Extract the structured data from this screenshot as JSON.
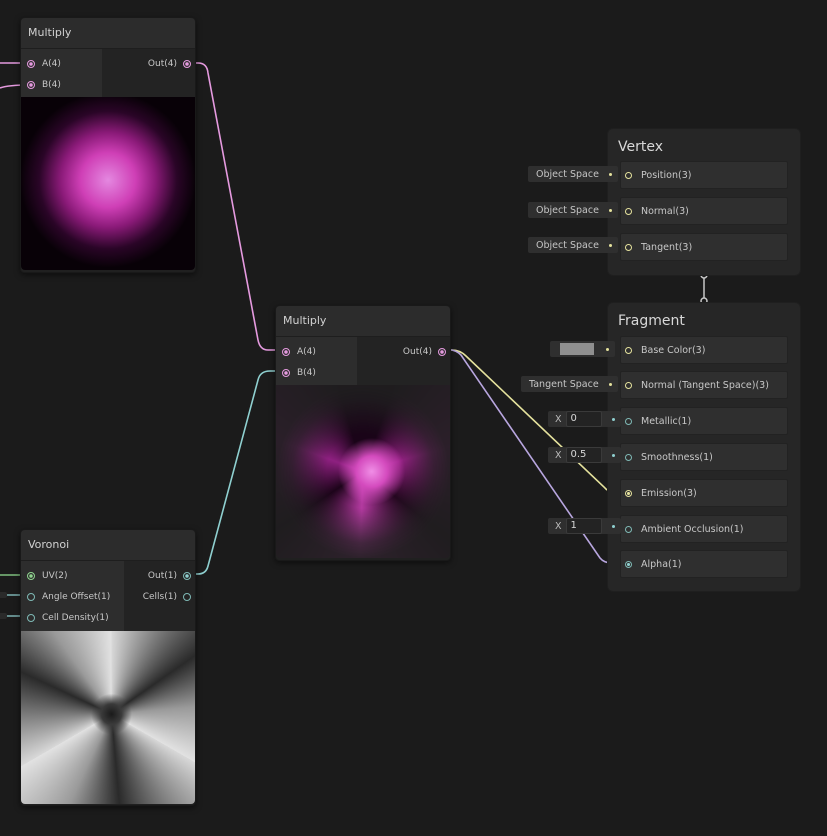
{
  "nodes": {
    "multiply_top": {
      "title": "Multiply",
      "inputs": [
        "A(4)",
        "B(4)"
      ],
      "outputs": [
        "Out(4)"
      ]
    },
    "multiply_center": {
      "title": "Multiply",
      "inputs": [
        "A(4)",
        "B(4)"
      ],
      "outputs": [
        "Out(4)"
      ]
    },
    "voronoi": {
      "title": "Voronoi",
      "inputs": [
        "UV(2)",
        "Angle Offset(1)",
        "Cell Density(1)"
      ],
      "outputs": [
        "Out(1)",
        "Cells(1)"
      ]
    }
  },
  "master": {
    "vertex": {
      "title": "Vertex",
      "slots": [
        {
          "label": "Position(3)",
          "input": "Object Space"
        },
        {
          "label": "Normal(3)",
          "input": "Object Space"
        },
        {
          "label": "Tangent(3)",
          "input": "Object Space"
        }
      ]
    },
    "fragment": {
      "title": "Fragment",
      "slots": [
        {
          "label": "Base Color(3)"
        },
        {
          "label": "Normal (Tangent Space)(3)",
          "input": "Tangent Space"
        },
        {
          "label": "Metallic(1)",
          "axis": "X",
          "value": "0"
        },
        {
          "label": "Smoothness(1)",
          "axis": "X",
          "value": "0.5"
        },
        {
          "label": "Emission(3)"
        },
        {
          "label": "Ambient Occlusion(1)",
          "axis": "X",
          "value": "1"
        },
        {
          "label": "Alpha(1)"
        }
      ]
    }
  },
  "colors": {
    "background": "#1b1b1b",
    "wire_vector4": "#e59adf",
    "wire_float": "#8fd0d0",
    "wire_vector3": "#e5e29d",
    "base_color_swatch": "#8f8f8f"
  }
}
